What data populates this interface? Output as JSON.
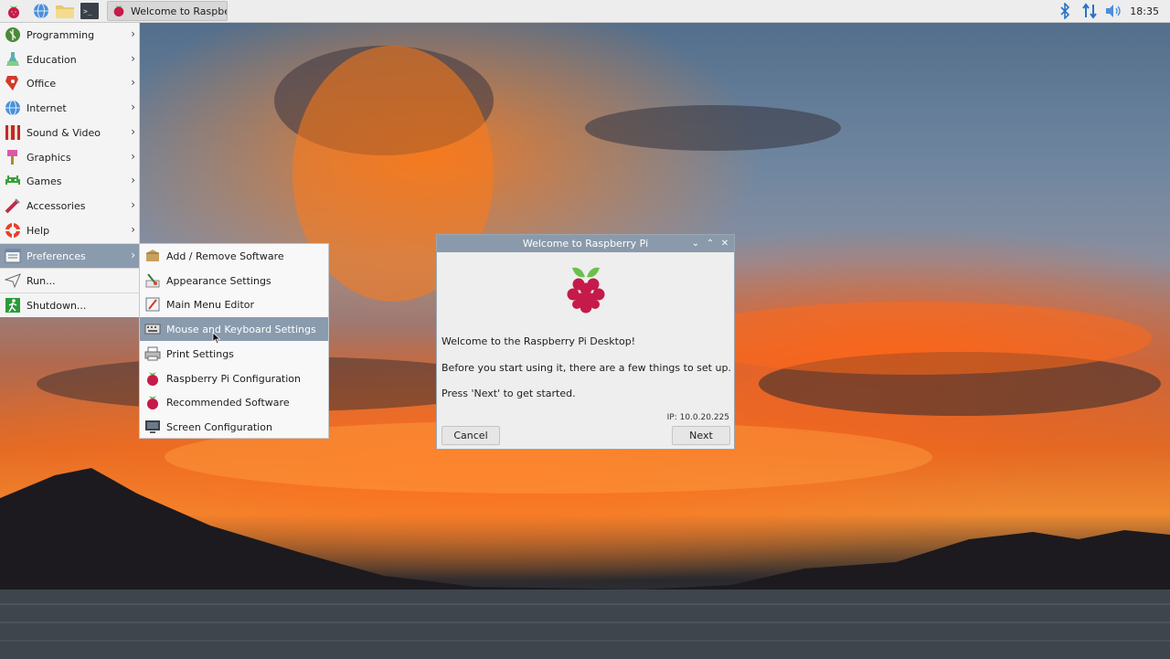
{
  "taskbar": {
    "task_title": "Welcome to Raspber...",
    "clock": "18:35",
    "icons": [
      "raspberry-menu-icon",
      "web-browser-icon",
      "file-manager-icon",
      "terminal-icon",
      "bluetooth-icon",
      "network-icon",
      "volume-icon"
    ]
  },
  "main_menu": {
    "items": [
      {
        "label": "Programming",
        "icon": "programming-icon",
        "submenu": true
      },
      {
        "label": "Education",
        "icon": "education-icon",
        "submenu": true
      },
      {
        "label": "Office",
        "icon": "office-icon",
        "submenu": true
      },
      {
        "label": "Internet",
        "icon": "internet-icon",
        "submenu": true
      },
      {
        "label": "Sound & Video",
        "icon": "sound-video-icon",
        "submenu": true
      },
      {
        "label": "Graphics",
        "icon": "graphics-icon",
        "submenu": true
      },
      {
        "label": "Games",
        "icon": "games-icon",
        "submenu": true
      },
      {
        "label": "Accessories",
        "icon": "accessories-icon",
        "submenu": true
      },
      {
        "label": "Help",
        "icon": "help-icon",
        "submenu": true
      },
      {
        "label": "Preferences",
        "icon": "preferences-icon",
        "submenu": true,
        "active": true
      },
      {
        "label": "Run...",
        "icon": "run-icon",
        "submenu": false
      },
      {
        "label": "Shutdown...",
        "icon": "shutdown-icon",
        "submenu": false
      }
    ]
  },
  "preferences_submenu": {
    "items": [
      {
        "label": "Add / Remove Software",
        "icon": "package-icon"
      },
      {
        "label": "Appearance Settings",
        "icon": "appearance-icon"
      },
      {
        "label": "Main Menu Editor",
        "icon": "menu-editor-icon"
      },
      {
        "label": "Mouse and Keyboard Settings",
        "icon": "keyboard-icon",
        "active": true
      },
      {
        "label": "Print Settings",
        "icon": "printer-icon"
      },
      {
        "label": "Raspberry Pi Configuration",
        "icon": "raspberry-icon"
      },
      {
        "label": "Recommended Software",
        "icon": "raspberry-icon"
      },
      {
        "label": "Screen Configuration",
        "icon": "monitor-icon"
      }
    ]
  },
  "dialog": {
    "title": "Welcome to Raspberry Pi",
    "welcome": "Welcome to the Raspberry Pi Desktop!",
    "setup_text": "Before you start using it, there are a few things to set up.",
    "instruction": "Press 'Next' to get started.",
    "ip": "IP: 10.0.20.225",
    "cancel_label": "Cancel",
    "next_label": "Next"
  },
  "colors": {
    "highlight": "#8a9bae",
    "titlebar": "#8a9aab",
    "panel": "#ededed",
    "raspberry": "#c51a4a",
    "leaf": "#6cc04a"
  }
}
